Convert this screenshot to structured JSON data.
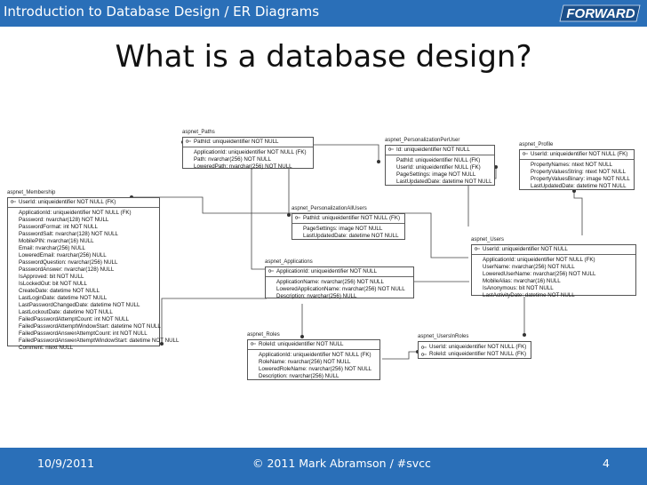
{
  "header": {
    "title": "Introduction to Database Design / ER Diagrams",
    "logo_text": "FORWARD"
  },
  "slide": {
    "title": "What is a database design?"
  },
  "footer": {
    "date": "10/9/2011",
    "copyright": "© 2011 Mark Abramson / #svcc",
    "page": "4"
  },
  "entities": {
    "paths": {
      "name": "aspnet_Paths",
      "pk": "PathId: uniqueidentifier NOT NULL",
      "fields": [
        "ApplicationId: uniqueidentifier NOT NULL (FK)",
        "Path: nvarchar(256) NOT NULL",
        "LoweredPath: nvarchar(256) NOT NULL"
      ]
    },
    "ppu": {
      "name": "aspnet_PersonalizationPerUser",
      "pk": "Id: uniqueidentifier NOT NULL",
      "fields": [
        "PathId: uniqueidentifier NULL (FK)",
        "UserId: uniqueidentifier NULL (FK)",
        "PageSettings: image NOT NULL",
        "LastUpdatedDate: datetime NOT NULL"
      ]
    },
    "profile": {
      "name": "aspnet_Profile",
      "pk": "UserId: uniqueidentifier NOT NULL (FK)",
      "fields": [
        "PropertyNames: ntext NOT NULL",
        "PropertyValuesString: ntext NOT NULL",
        "PropertyValuesBinary: image NOT NULL",
        "LastUpdatedDate: datetime NOT NULL"
      ]
    },
    "membership": {
      "name": "aspnet_Membership",
      "pk": "UserId: uniqueidentifier NOT NULL (FK)",
      "fields": [
        "ApplicationId: uniqueidentifier NOT NULL (FK)",
        "Password: nvarchar(128) NOT NULL",
        "PasswordFormat: int NOT NULL",
        "PasswordSalt: nvarchar(128) NOT NULL",
        "MobilePIN: nvarchar(16) NULL",
        "Email: nvarchar(256) NULL",
        "LoweredEmail: nvarchar(256) NULL",
        "PasswordQuestion: nvarchar(256) NULL",
        "PasswordAnswer: nvarchar(128) NULL",
        "IsApproved: bit NOT NULL",
        "IsLockedOut: bit NOT NULL",
        "CreateDate: datetime NOT NULL",
        "LastLoginDate: datetime NOT NULL",
        "LastPasswordChangedDate: datetime NOT NULL",
        "LastLockoutDate: datetime NOT NULL",
        "FailedPasswordAttemptCount: int NOT NULL",
        "FailedPasswordAttemptWindowStart: datetime NOT NULL",
        "FailedPasswordAnswerAttemptCount: int NOT NULL",
        "FailedPasswordAnswerAttemptWindowStart: datetime NOT NULL",
        "Comment: ntext NULL"
      ]
    },
    "pau": {
      "name": "aspnet_PersonalizationAllUsers",
      "pk": "PathId: uniqueidentifier NOT NULL (FK)",
      "fields": [
        "PageSettings: image NOT NULL",
        "LastUpdatedDate: datetime NOT NULL"
      ]
    },
    "users": {
      "name": "aspnet_Users",
      "pk": "UserId: uniqueidentifier NOT NULL",
      "fields": [
        "ApplicationId: uniqueidentifier NOT NULL (FK)",
        "UserName: nvarchar(256) NOT NULL",
        "LoweredUserName: nvarchar(256) NOT NULL",
        "MobileAlias: nvarchar(16) NULL",
        "IsAnonymous: bit NOT NULL",
        "LastActivityDate: datetime NOT NULL"
      ]
    },
    "applications": {
      "name": "aspnet_Applications",
      "pk": "ApplicationId: uniqueidentifier NOT NULL",
      "fields": [
        "ApplicationName: nvarchar(256) NOT NULL",
        "LoweredApplicationName: nvarchar(256) NOT NULL",
        "Description: nvarchar(256) NULL"
      ]
    },
    "roles": {
      "name": "aspnet_Roles",
      "pk": "RoleId: uniqueidentifier NOT NULL",
      "fields": [
        "ApplicationId: uniqueidentifier NOT NULL (FK)",
        "RoleName: nvarchar(256) NOT NULL",
        "LoweredRoleName: nvarchar(256) NOT NULL",
        "Description: nvarchar(256) NULL"
      ]
    },
    "uir": {
      "name": "aspnet_UsersInRoles",
      "pk": "",
      "fields": [
        "UserId: uniqueidentifier NOT NULL (FK)",
        "RoleId: uniqueidentifier NOT NULL (FK)"
      ]
    }
  }
}
